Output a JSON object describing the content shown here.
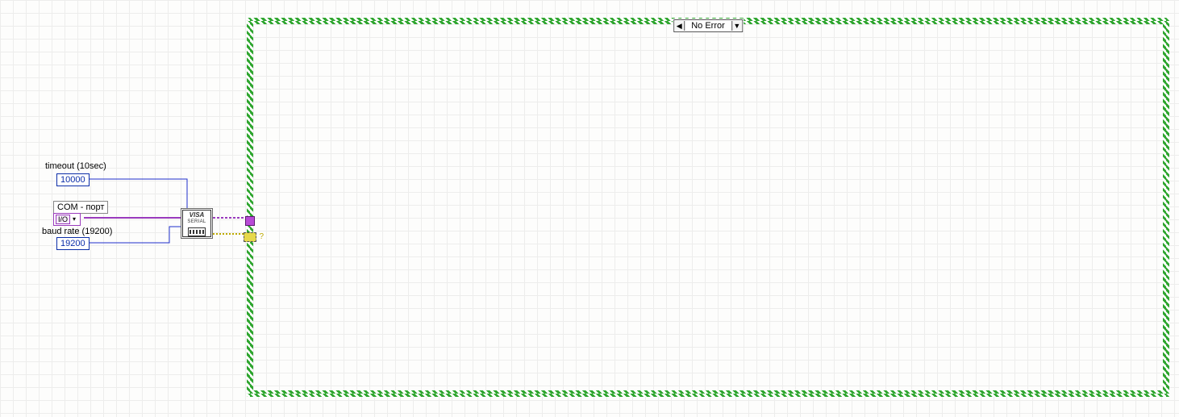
{
  "labels": {
    "timeout": "timeout (10sec)",
    "com_port": "COM - порт",
    "baud_rate": "baud rate (19200)"
  },
  "constants": {
    "timeout_value": "10000",
    "baud_value": "19200",
    "io_resource": "I/O"
  },
  "visa_node": {
    "title": "VISA",
    "subtitle": "SERIAL"
  },
  "case_structure": {
    "selector_label": "No Error",
    "left_arrow": "◀",
    "right_arrow": "▼"
  }
}
